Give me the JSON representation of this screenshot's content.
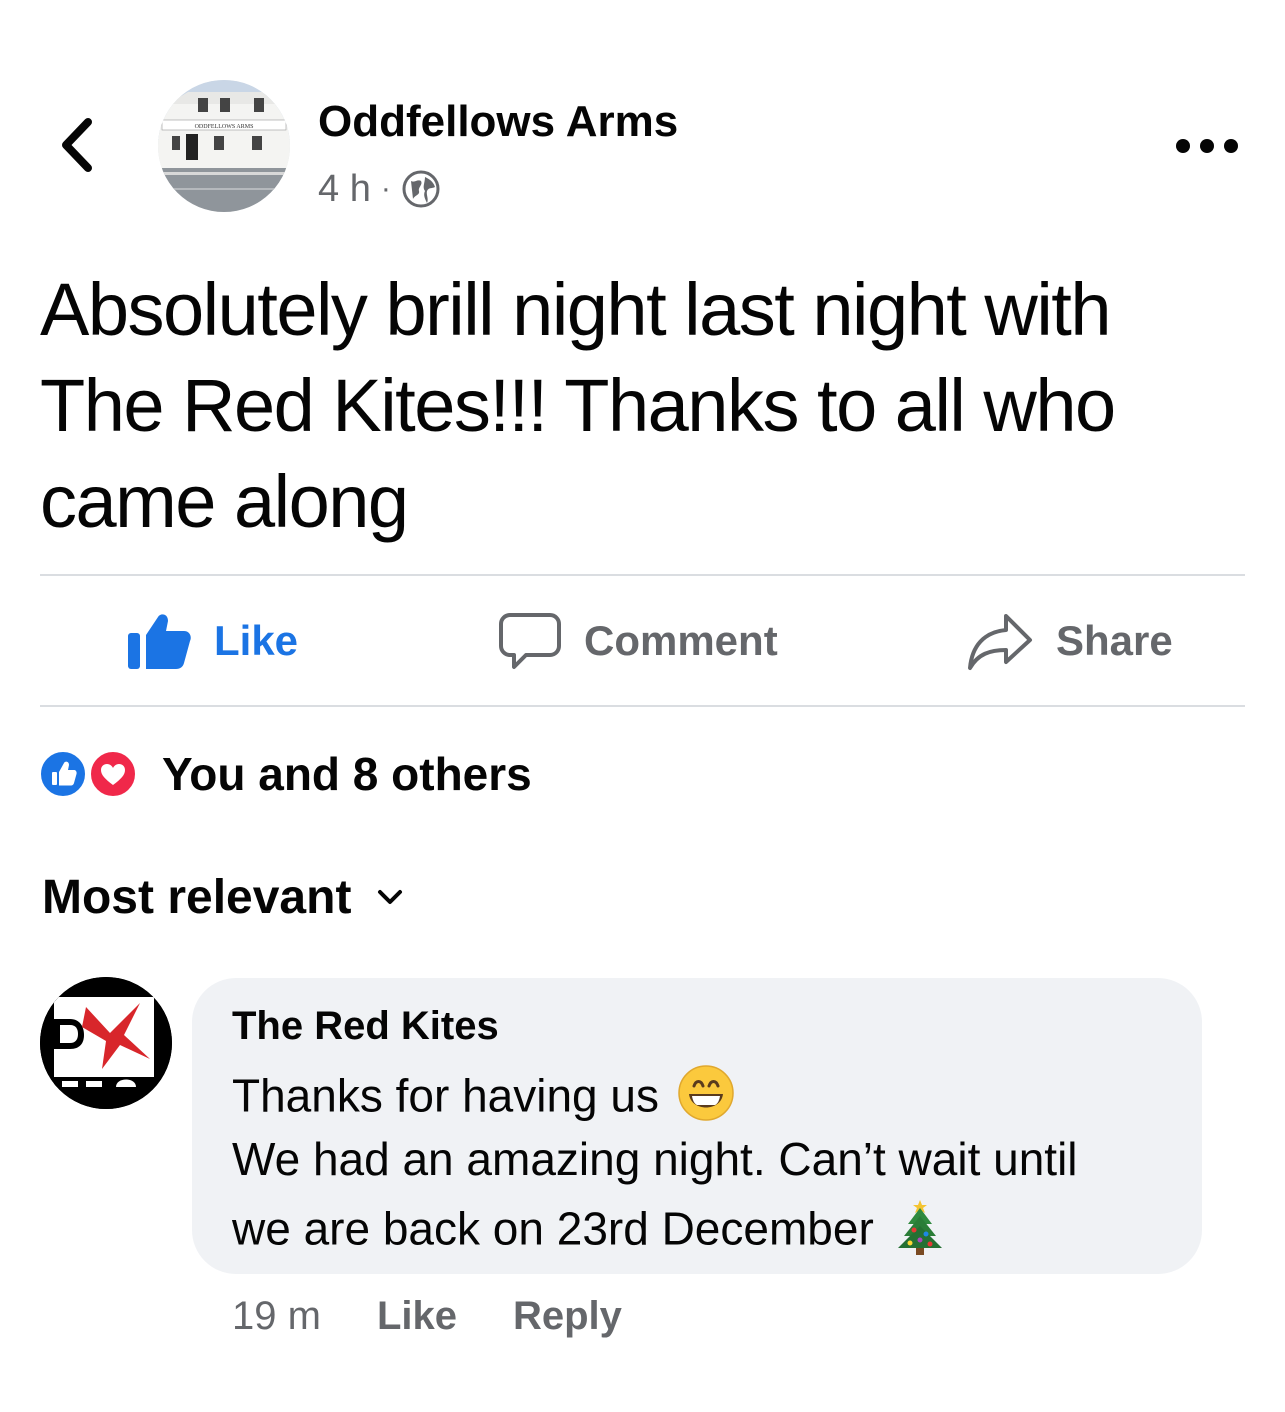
{
  "header": {
    "page_name": "Oddfellows Arms",
    "time": "4 h",
    "separator": "·",
    "avatar_sign": "ODDFELLOWS ARMS"
  },
  "post": {
    "lines": [
      "Absolutely brill night last night with",
      "The Red Kites!!! Thanks to all who",
      "came along"
    ]
  },
  "actions": {
    "like": "Like",
    "comment": "Comment",
    "share": "Share"
  },
  "reactions": {
    "summary": "You and 8 others"
  },
  "sort": {
    "label": "Most relevant"
  },
  "comment": {
    "author": "The Red Kites",
    "line1": "Thanks for having us",
    "line2": "We had an amazing night. Can’t wait until",
    "line3": "we are back on 23rd December",
    "time": "19 m",
    "like": "Like",
    "reply": "Reply"
  },
  "colors": {
    "accent": "#1b74e4",
    "love": "#f0284a",
    "muted": "#65676b",
    "bubble": "#f0f2f5"
  }
}
